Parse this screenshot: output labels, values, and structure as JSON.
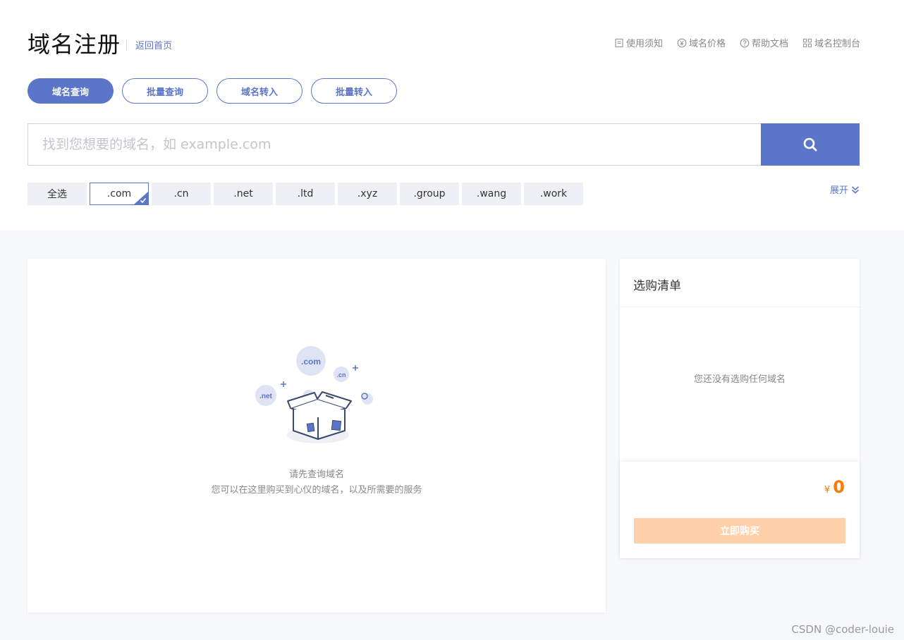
{
  "header": {
    "title": "域名注册",
    "back_home": "返回首页",
    "links": [
      {
        "label": "使用须知",
        "icon": "document-icon"
      },
      {
        "label": "域名价格",
        "icon": "yen-icon"
      },
      {
        "label": "帮助文档",
        "icon": "help-icon"
      },
      {
        "label": "域名控制台",
        "icon": "grid-icon"
      }
    ]
  },
  "tabs": [
    {
      "label": "域名查询",
      "active": true
    },
    {
      "label": "批量查询",
      "active": false
    },
    {
      "label": "域名转入",
      "active": false
    },
    {
      "label": "批量转入",
      "active": false
    }
  ],
  "search": {
    "placeholder": "找到您想要的域名，如 example.com",
    "value": "",
    "button_icon": "search-icon"
  },
  "suffixes": [
    {
      "label": "全选",
      "selected": false
    },
    {
      "label": ".com",
      "selected": true
    },
    {
      "label": ".cn",
      "selected": false
    },
    {
      "label": ".net",
      "selected": false
    },
    {
      "label": ".ltd",
      "selected": false
    },
    {
      "label": ".xyz",
      "selected": false
    },
    {
      "label": ".group",
      "selected": false
    },
    {
      "label": ".wang",
      "selected": false
    },
    {
      "label": ".work",
      "selected": false
    }
  ],
  "expand_label": "展开",
  "results": {
    "illustration_bubbles": [
      ".com",
      ".cn",
      ".net"
    ],
    "empty_title": "请先查询域名",
    "empty_desc": "您可以在这里购买到心仪的域名，以及所需要的服务"
  },
  "cart": {
    "title": "选购清单",
    "empty_text": "您还没有选购任何域名",
    "currency": "¥",
    "total": "0",
    "buy_label": "立即购买"
  },
  "watermark": "CSDN @coder-louie",
  "colors": {
    "primary": "#5b76c8",
    "price": "#ff7a00",
    "buy_disabled": "#ffd1aa"
  }
}
